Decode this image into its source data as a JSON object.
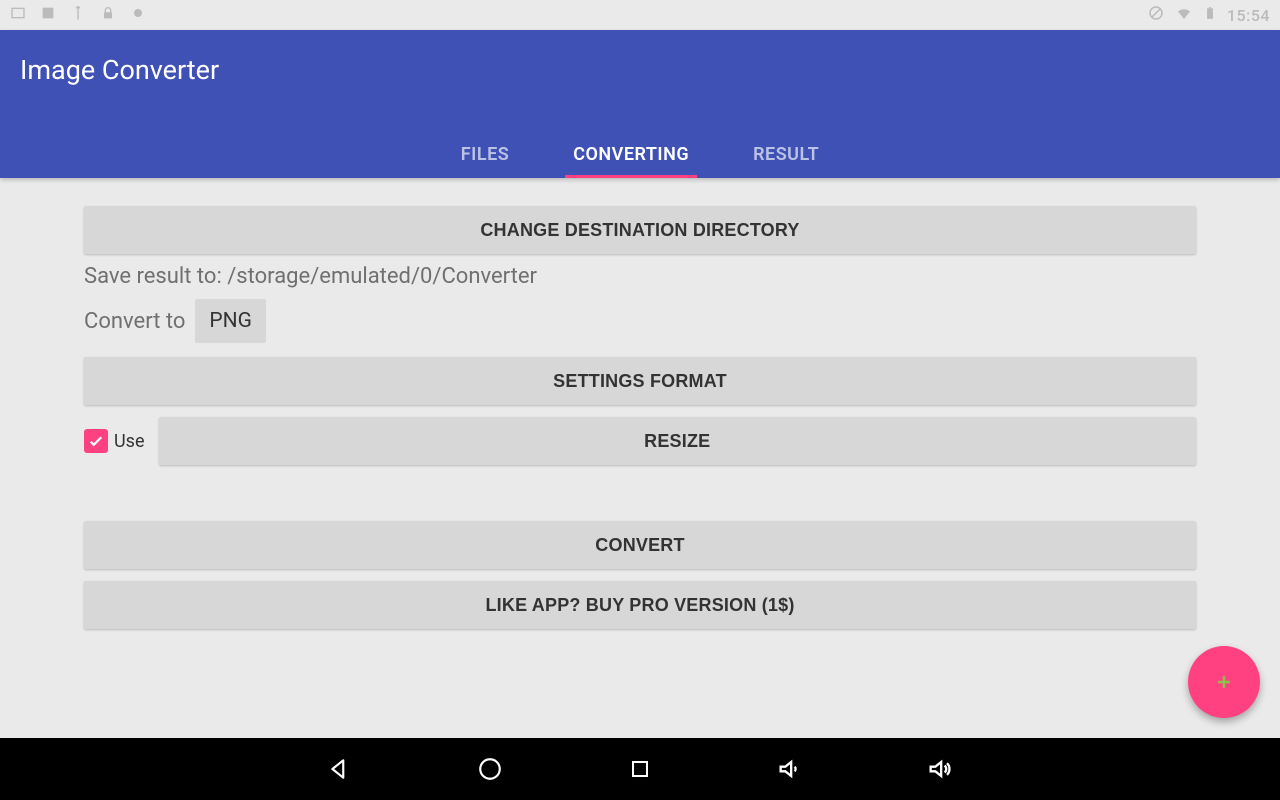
{
  "status": {
    "time": "15:54"
  },
  "app": {
    "title": "Image Converter"
  },
  "tabs": {
    "files": "FILES",
    "converting": "CONVERTING",
    "result": "RESULT"
  },
  "buttons": {
    "change_dir": "CHANGE DESTINATION DIRECTORY",
    "settings_format": "SETTINGS FORMAT",
    "resize": "RESIZE",
    "convert": "CONVERT",
    "buy_pro": "LIKE APP? BUY PRO VERSION (1$)"
  },
  "labels": {
    "save_to": "Save result to: /storage/emulated/0/Converter",
    "convert_to": "Convert to",
    "use": "Use"
  },
  "format": {
    "selected": "PNG"
  }
}
